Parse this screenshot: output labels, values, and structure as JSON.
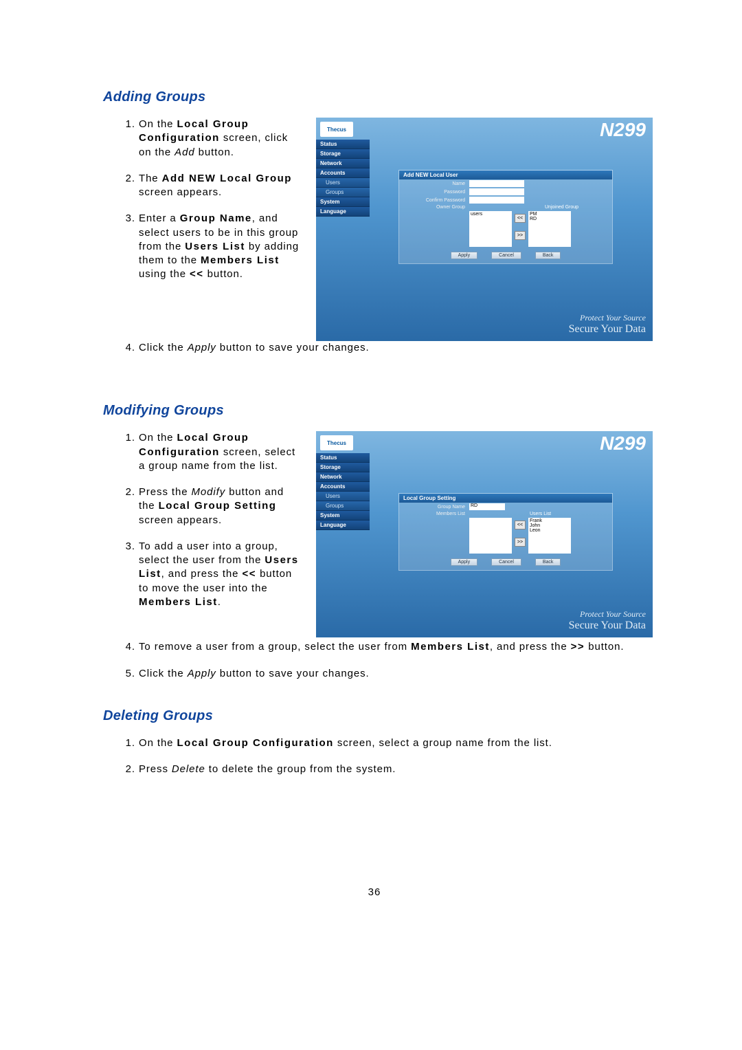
{
  "page_number": "36",
  "sections": {
    "adding": {
      "title": "Adding Groups",
      "steps": [
        {
          "pre": "On the ",
          "b": "Local Group Configuration",
          "post": " screen, click on the ",
          "i": "Add",
          "tail": " button."
        },
        {
          "pre": "The ",
          "b": "Add NEW Local Group",
          "post": " screen appears.",
          "i": "",
          "tail": ""
        },
        {
          "pre": "Enter a ",
          "b": "Group Name",
          "post": ", and select users to be in this group from the ",
          "b2": "Users List",
          "post2": " by adding them to the ",
          "b3": "Members List",
          "post3": " using the ",
          "b4": "<<",
          "post4": " button."
        },
        {
          "pre": "Click the ",
          "i": "Apply",
          "post": " button to save your changes."
        }
      ]
    },
    "modifying": {
      "title": "Modifying Groups",
      "steps": [
        {
          "pre": "On the ",
          "b": "Local Group Configuration",
          "post": " screen, select a group name from the list."
        },
        {
          "pre": "Press the ",
          "i": "Modify",
          "post": " button and the ",
          "b": "Local Group Setting",
          "post2": " screen appears."
        },
        {
          "pre": "To add a user into a group, select the user from the ",
          "b": "Users List",
          "post": ", and press the ",
          "b2": "<<",
          "post2": " button to move the user into the ",
          "b3": "Members List",
          "post3": "."
        },
        {
          "pre": "To remove a user from a group, select the user from ",
          "b": "Members List",
          "post": ", and press the ",
          "b2": ">>",
          "post2": " button."
        },
        {
          "pre": "Click the ",
          "i": "Apply",
          "post": " button to save your changes."
        }
      ]
    },
    "deleting": {
      "title": "Deleting Groups",
      "steps": [
        {
          "pre": "On the ",
          "b": "Local Group Configuration",
          "post": " screen, select a group name from the list."
        },
        {
          "pre": "Press ",
          "i": "Delete",
          "post": " to delete the group from the system."
        }
      ]
    }
  },
  "screenshot1": {
    "logo": "Thecus",
    "model": "N299",
    "sidebar": [
      "Status",
      "Storage",
      "Network",
      "Accounts",
      "Users",
      "Groups",
      "System",
      "Language"
    ],
    "panel_title": "Add NEW Local User",
    "fields": [
      "Name",
      "Password",
      "Confirm Password"
    ],
    "col1": "Owner Group",
    "col2": "Unjoined Group",
    "list_left": [
      "users"
    ],
    "list_right": [
      "PM",
      "RD"
    ],
    "btn_left": "<<",
    "btn_right": ">>",
    "buttons": [
      "Apply",
      "Cancel",
      "Back"
    ],
    "footer1": "Protect Your Source",
    "footer2": "Secure Your Data"
  },
  "screenshot2": {
    "logo": "Thecus",
    "model": "N299",
    "sidebar": [
      "Status",
      "Storage",
      "Network",
      "Accounts",
      "Users",
      "Groups",
      "System",
      "Language"
    ],
    "panel_title": "Local Group Setting",
    "label_group": "Group Name",
    "group_value": "RD",
    "label_members": "Members List",
    "label_users": "Users List",
    "users_list": [
      "Frank",
      "John",
      "Leon"
    ],
    "btn_left": "<<",
    "btn_right": ">>",
    "buttons": [
      "Apply",
      "Cancel",
      "Back"
    ],
    "footer1": "Protect Your Source",
    "footer2": "Secure Your Data"
  }
}
